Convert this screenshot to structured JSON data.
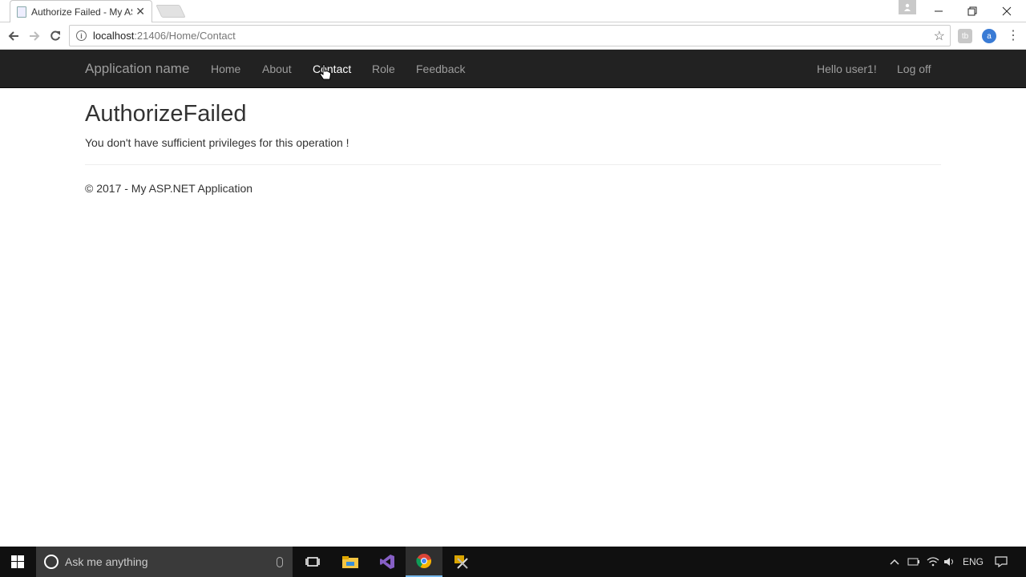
{
  "browser": {
    "tab_title": "Authorize Failed - My AS",
    "url_host": "localhost",
    "url_rest": ":21406/Home/Contact",
    "extensions": [
      "tb-extension-icon",
      "a-extension-icon"
    ],
    "ext_a_label": "a"
  },
  "navbar": {
    "brand": "Application name",
    "links": [
      {
        "label": "Home"
      },
      {
        "label": "About"
      },
      {
        "label": "Contact",
        "active": true
      },
      {
        "label": "Role"
      },
      {
        "label": "Feedback"
      }
    ],
    "greeting": "Hello user1!",
    "logoff": "Log off"
  },
  "main": {
    "title": "AuthorizeFailed",
    "message": "You don't have sufficient privileges for this operation !"
  },
  "footer": {
    "text": "© 2017 - My ASP.NET Application"
  },
  "taskbar": {
    "search_placeholder": "Ask me anything",
    "language": "ENG"
  },
  "colors": {
    "navbar_bg": "#222222",
    "navlink": "#9d9d9d",
    "navlink_active": "#ffffff",
    "taskbar_bg": "#101010"
  }
}
